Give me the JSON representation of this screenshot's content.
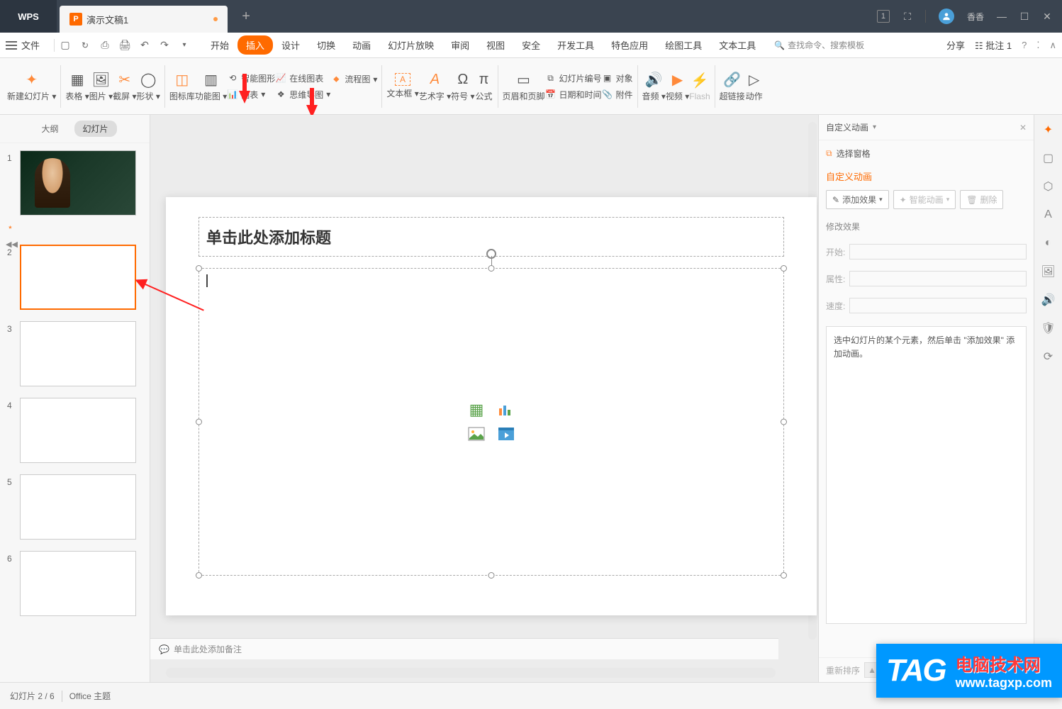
{
  "titlebar": {
    "app_name": "WPS",
    "doc_name": "演示文稿1",
    "user_name": "香香"
  },
  "menubar": {
    "file": "文件",
    "items": [
      "开始",
      "插入",
      "设计",
      "切换",
      "动画",
      "幻灯片放映",
      "审阅",
      "视图",
      "安全",
      "开发工具",
      "特色应用",
      "绘图工具",
      "文本工具"
    ],
    "active": "插入",
    "search_placeholder": "查找命令、搜索模板",
    "share": "分享",
    "comments": "批注 1"
  },
  "ribbon": {
    "new_slide": "新建幻灯片",
    "table": "表格",
    "picture": "图片",
    "screenshot": "截屏",
    "shape": "形状",
    "icon_lib": "图标库",
    "smart_drawing": "功能图",
    "smart_art": "智能图形",
    "chart": "图表",
    "online_chart": "在线图表",
    "flowchart": "流程图",
    "mindmap": "思维导图",
    "textbox": "文本框",
    "wordart": "艺术字",
    "symbol": "符号",
    "equation": "公式",
    "header_footer": "页眉和页脚",
    "slide_number": "幻灯片编号",
    "datetime": "日期和时间",
    "object": "对象",
    "attachment": "附件",
    "audio": "音频",
    "video": "视频",
    "flash": "Flash",
    "hyperlink": "超链接",
    "action": "动作"
  },
  "slide_panel": {
    "tab_outline": "大纲",
    "tab_slides": "幻灯片",
    "slides": [
      {
        "num": "1",
        "star": "⋆"
      },
      {
        "num": "2"
      },
      {
        "num": "3"
      },
      {
        "num": "4"
      },
      {
        "num": "5"
      },
      {
        "num": "6"
      }
    ]
  },
  "canvas": {
    "title_placeholder": "单击此处添加标题",
    "notes_placeholder": "单击此处添加备注"
  },
  "anim_panel": {
    "title": "自定义动画",
    "select_pane": "选择窗格",
    "section_title": "自定义动画",
    "add_effect": "添加效果",
    "smart_anim": "智能动画",
    "delete": "删除",
    "modify_title": "修改效果",
    "start": "开始:",
    "property": "属性:",
    "speed": "速度:",
    "hint": "选中幻灯片的某个元素，然后单击 \"添加效果\" 添加动画。",
    "reorder": "重新排序"
  },
  "statusbar": {
    "slide_count": "幻灯片 2 / 6",
    "theme": "Office 主题"
  },
  "watermark": {
    "tag": "TAG",
    "cn": "电脑技术网",
    "url": "www.tagxp.com"
  }
}
